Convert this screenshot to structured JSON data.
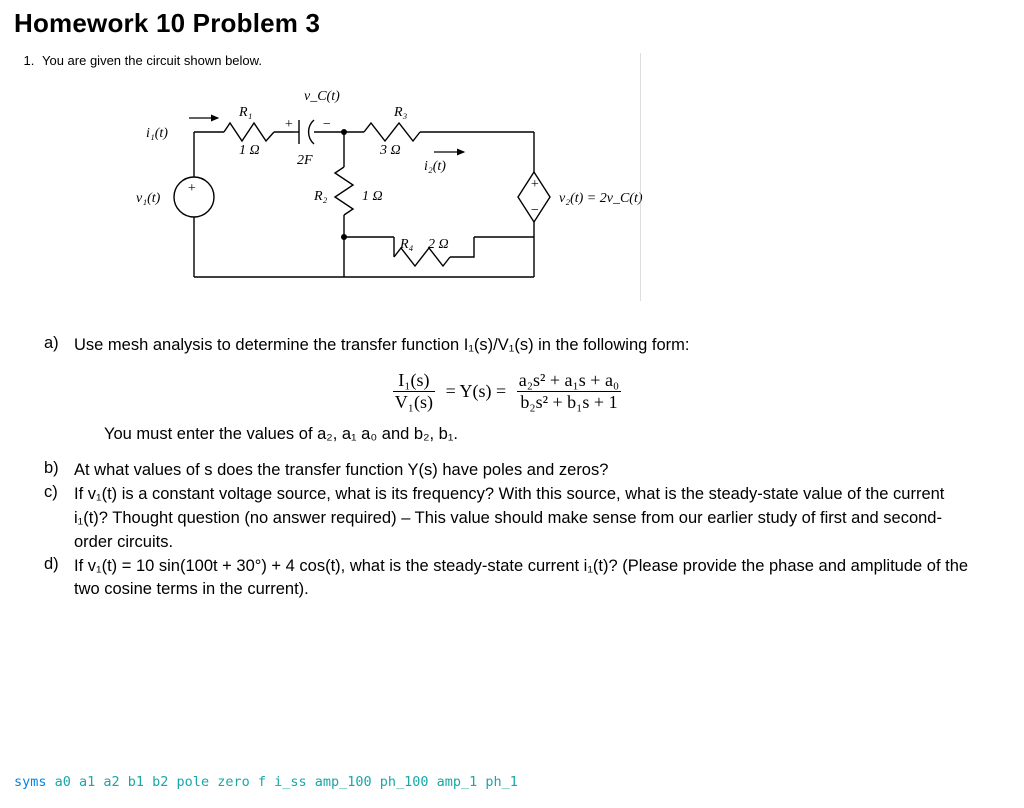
{
  "title": "Homework 10 Problem 3",
  "prompt_number": "1.",
  "prompt_text": "You are given the circuit shown below.",
  "circuit": {
    "vc_t": "v_C(t)",
    "R1": "R₁",
    "R1_val": "1 Ω",
    "cap_val": "2F",
    "cap_plus": "+",
    "cap_minus": "−",
    "R3": "R₃",
    "R3_val": "3 Ω",
    "i1_t": "i₁(t)",
    "i2_t": "i₂(t)",
    "v1_t": "v₁(t)",
    "src_plus": "+",
    "R2": "R₂",
    "R2_val": "1 Ω",
    "dep_plus": "+",
    "dep_minus": "−",
    "v2_t": "v₂(t) = 2v_C(t)",
    "R4": "R₄",
    "R4_val": "2 Ω"
  },
  "questions": {
    "a_letter": "a)",
    "a_text_1": "Use mesh analysis to determine the transfer function I₁(s)/V₁(s) in the following form:",
    "a_eq_num1": "I₁(s)",
    "a_eq_den1": "V₁(s)",
    "a_eq_mid": " = Y(s) = ",
    "a_eq_num2": "a₂s² + a₁s + a₀",
    "a_eq_den2": "b₂s² + b₁s + 1",
    "a_followup": "You must enter the values of a₂, a₁ a₀ and b₂, b₁.",
    "b_letter": "b)",
    "b_text": "At what values of s does the transfer function Y(s) have poles and zeros?",
    "c_letter": "c)",
    "c_text": "If v₁(t) is a constant voltage source, what is its frequency?   With this source, what is the steady-state value of the current i₁(t)?   Thought question (no answer required) – This value should make sense from our earlier study of first and second-order circuits.",
    "d_letter": "d)",
    "d_text": "If v₁(t) = 10 sin(100t + 30°) + 4 cos(t), what is the steady-state current i₁(t)?  (Please provide the phase and amplitude of the two cosine terms in the current)."
  },
  "code": {
    "kw": "syms ",
    "vars": "a0 a1 a2 b1 b2 pole zero f i_ss amp_100 ph_100 amp_1 ph_1"
  }
}
